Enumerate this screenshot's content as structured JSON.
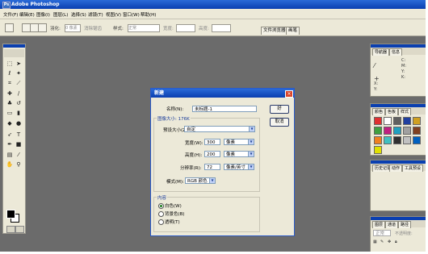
{
  "window": {
    "title": "Adobe Photoshop",
    "app_icon": "ps-icon"
  },
  "menu": [
    "文件(F)",
    "编辑(E)",
    "图像(I)",
    "图层(L)",
    "选择(S)",
    "滤镜(T)",
    "视图(V)",
    "窗口(W)",
    "帮助(H)"
  ],
  "options": {
    "feather_label": "羽化:",
    "feather_value": "0 像素",
    "antialias_label": "消除锯齿",
    "style_label": "样式:",
    "style_value": "正常",
    "width_label": "宽度:",
    "height_label": "高度:"
  },
  "palette_well": {
    "tabs": [
      "文件浏览器",
      "画笔"
    ]
  },
  "panels": {
    "navigator": {
      "tabs": [
        "导航器",
        "信息"
      ],
      "info_c": "C:",
      "info_m": "M:",
      "info_y": "Y:",
      "info_k": "K:",
      "info_x": "X:",
      "info_y2": "Y:"
    },
    "swatches": {
      "tabs": [
        "颜色",
        "色板",
        "样式"
      ]
    },
    "history": {
      "tabs": [
        "历史记录",
        "动作",
        "工具预设"
      ]
    },
    "layers": {
      "tabs": [
        "图层",
        "通道",
        "路径"
      ],
      "mode": "正常",
      "opacity_label": "不透明度:"
    }
  },
  "dialog": {
    "title": "新建",
    "name_label": "名称(N):",
    "name_value": "未标题-1",
    "ok": "好",
    "cancel": "取消",
    "image_size": "图像大小: 176K",
    "preset_label": "预设大小(Z):",
    "preset_value": "自定",
    "width_label": "宽度(W):",
    "width_value": "300",
    "width_unit": "像素",
    "height_label": "高度(H):",
    "height_value": "200",
    "height_unit": "像素",
    "resolution_label": "分辨率(R):",
    "resolution_value": "72",
    "resolution_unit": "像素/英寸",
    "mode_label": "模式(M):",
    "mode_value": "RGB 颜色",
    "contents_title": "内容",
    "contents": [
      {
        "label": "白色(W)",
        "selected": true
      },
      {
        "label": "背景色(B)",
        "selected": false
      },
      {
        "label": "透明(T)",
        "selected": false
      }
    ]
  },
  "colors": {
    "foreground": "#000000",
    "background": "#ffffff",
    "swatches": [
      "#e03030",
      "#ffffff",
      "#606060",
      "#2040a0",
      "#d0a020",
      "#40a040",
      "#c02080",
      "#20a0c0",
      "#a0a0a0",
      "#804020",
      "#f08020",
      "#40c0c0",
      "#303030",
      "#c0c0c0",
      "#0060c0",
      "#e0e000"
    ]
  }
}
